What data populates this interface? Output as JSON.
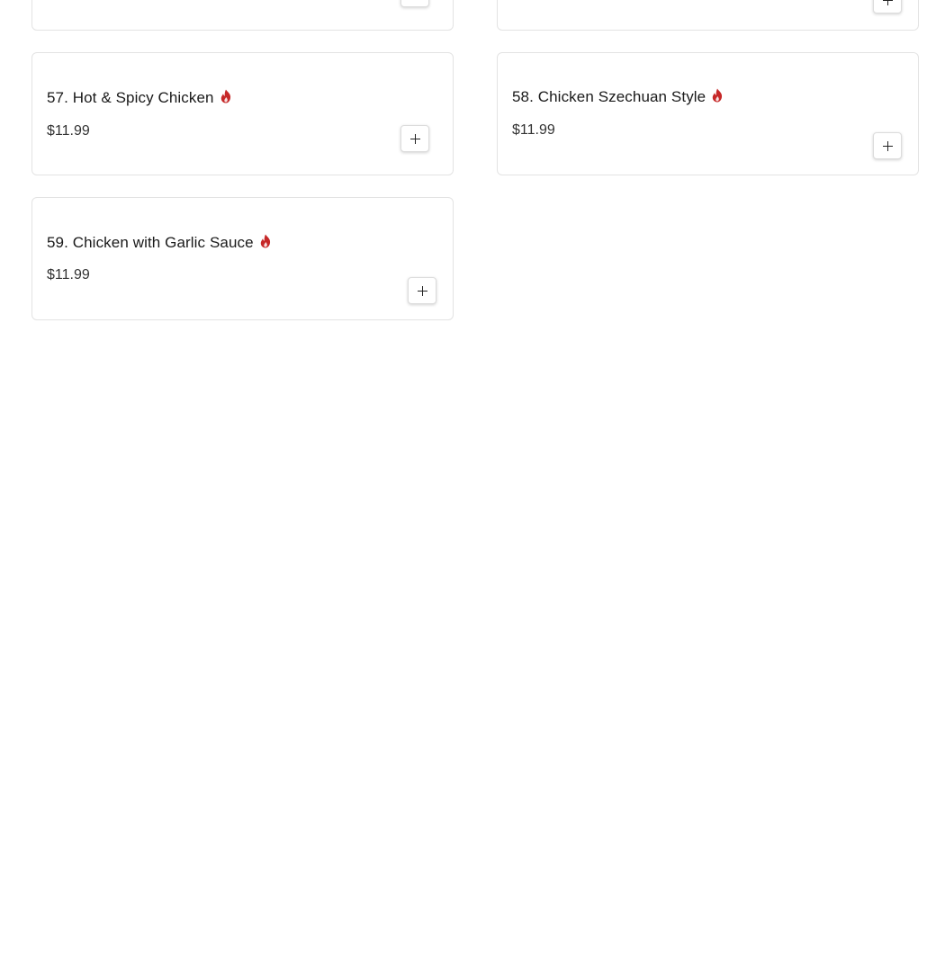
{
  "menu": {
    "items": [
      {
        "name": "57. Hot & Spicy Chicken",
        "price": "$11.99",
        "spicy": true,
        "add_icon": "plus-icon"
      },
      {
        "name": "58. Chicken Szechuan Style",
        "price": "$11.99",
        "spicy": true,
        "add_icon": "plus-icon"
      },
      {
        "name": "59. Chicken with Garlic Sauce",
        "price": "$11.99",
        "spicy": true,
        "add_icon": "plus-icon"
      }
    ]
  },
  "colors": {
    "spicy": "#c62828",
    "card_border": "#e3e3e3",
    "text": "#1a1a1a"
  }
}
